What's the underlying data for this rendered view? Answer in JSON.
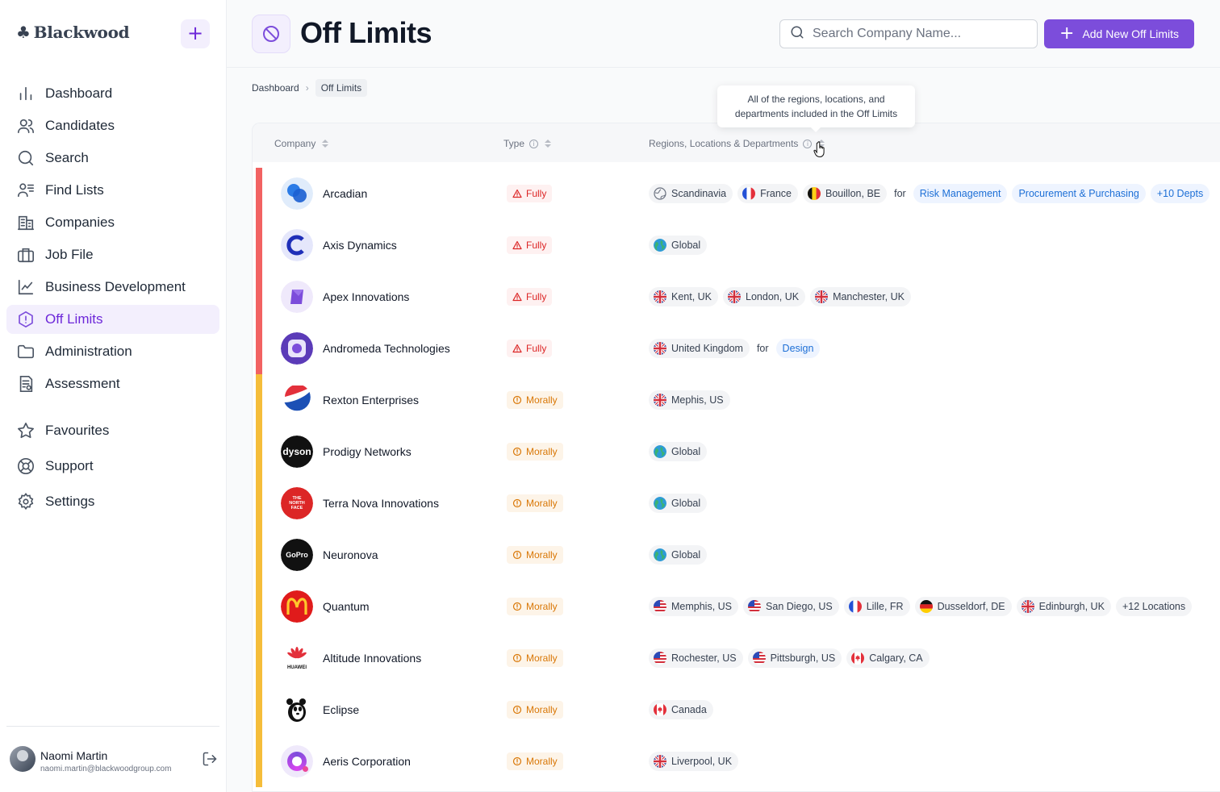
{
  "app": {
    "brand": "Blackwood"
  },
  "sidebar": {
    "items": [
      {
        "label": "Dashboard",
        "icon": "bar-chart-icon"
      },
      {
        "label": "Candidates",
        "icon": "users-icon"
      },
      {
        "label": "Search",
        "icon": "search-icon"
      },
      {
        "label": "Find Lists",
        "icon": "list-users-icon"
      },
      {
        "label": "Companies",
        "icon": "building-icon"
      },
      {
        "label": "Job File",
        "icon": "briefcase-icon"
      },
      {
        "label": "Business Development",
        "icon": "trend-chart-icon"
      },
      {
        "label": "Off Limits",
        "icon": "alert-hexagon-icon",
        "active": true
      },
      {
        "label": "Administration",
        "icon": "folder-icon"
      },
      {
        "label": "Assessment",
        "icon": "document-icon"
      }
    ],
    "secondary": [
      {
        "label": "Favourites",
        "icon": "star-icon"
      },
      {
        "label": "Support",
        "icon": "lifebuoy-icon"
      },
      {
        "label": "Settings",
        "icon": "gear-icon"
      }
    ],
    "user": {
      "name": "Naomi Martin",
      "email": "naomi.martin@blackwoodgroup.com"
    }
  },
  "header": {
    "title": "Off Limits",
    "search_placeholder": "Search Company Name...",
    "add_label": "Add New Off Limits"
  },
  "breadcrumb": {
    "root": "Dashboard",
    "current": "Off Limits"
  },
  "tooltip": {
    "line1": "All of the regions, locations, and",
    "line2": "departments included in the Off Limits"
  },
  "table": {
    "columns": {
      "company": "Company",
      "type": "Type",
      "regions": "Regions, Locations & Departments"
    },
    "connector": "for",
    "rows": [
      {
        "company": "Arcadian",
        "type": "Fully",
        "locations": [
          {
            "label": "Scandinavia",
            "flag": "region"
          },
          {
            "label": "France",
            "flag": "fr"
          },
          {
            "label": "Bouillon, BE",
            "flag": "be"
          }
        ],
        "departments": [
          "Risk Management",
          "Procurement & Purchasing",
          "+10 Depts"
        ]
      },
      {
        "company": "Axis Dynamics",
        "type": "Fully",
        "locations": [
          {
            "label": "Global",
            "flag": "globe"
          }
        ],
        "departments": []
      },
      {
        "company": "Apex Innovations",
        "type": "Fully",
        "locations": [
          {
            "label": "Kent, UK",
            "flag": "uk"
          },
          {
            "label": "London, UK",
            "flag": "uk"
          },
          {
            "label": "Manchester, UK",
            "flag": "uk"
          }
        ],
        "departments": []
      },
      {
        "company": "Andromeda Technologies",
        "type": "Fully",
        "locations": [
          {
            "label": "United Kingdom",
            "flag": "uk"
          }
        ],
        "departments": [
          "Design"
        ]
      },
      {
        "company": "Rexton Enterprises",
        "type": "Morally",
        "locations": [
          {
            "label": "Mephis, US",
            "flag": "uk"
          }
        ],
        "departments": []
      },
      {
        "company": "Prodigy Networks",
        "type": "Morally",
        "locations": [
          {
            "label": "Global",
            "flag": "globe"
          }
        ],
        "departments": []
      },
      {
        "company": "Terra Nova Innovations",
        "type": "Morally",
        "locations": [
          {
            "label": "Global",
            "flag": "globe"
          }
        ],
        "departments": []
      },
      {
        "company": "Neuronova",
        "type": "Morally",
        "locations": [
          {
            "label": "Global",
            "flag": "globe"
          }
        ],
        "departments": []
      },
      {
        "company": "Quantum",
        "type": "Morally",
        "locations": [
          {
            "label": "Memphis, US",
            "flag": "us"
          },
          {
            "label": "San Diego, US",
            "flag": "us"
          },
          {
            "label": "Lille, FR",
            "flag": "fr"
          },
          {
            "label": "Dusseldorf, DE",
            "flag": "de"
          },
          {
            "label": "Edinburgh, UK",
            "flag": "uk"
          },
          {
            "label": "+12 Locations",
            "flag": ""
          }
        ],
        "departments": []
      },
      {
        "company": "Altitude Innovations",
        "type": "Morally",
        "locations": [
          {
            "label": "Rochester, US",
            "flag": "us"
          },
          {
            "label": "Pittsburgh, US",
            "flag": "us"
          },
          {
            "label": "Calgary, CA",
            "flag": "ca"
          }
        ],
        "departments": []
      },
      {
        "company": "Eclipse",
        "type": "Morally",
        "locations": [
          {
            "label": "Canada",
            "flag": "ca"
          }
        ],
        "departments": []
      },
      {
        "company": "Aeris Corporation",
        "type": "Morally",
        "locations": [
          {
            "label": "Liverpool, UK",
            "flag": "uk"
          }
        ],
        "departments": []
      }
    ]
  },
  "logos": {
    "dyson": "dyson",
    "gopro": "GoPro",
    "huawei": "HUAWEI",
    "northface": "THE NORTH FACE"
  },
  "colors": {
    "accent": "#7c4ddb",
    "fully": "#f26262",
    "morally": "#f5bd3a",
    "dept": "#1d6fd6"
  }
}
